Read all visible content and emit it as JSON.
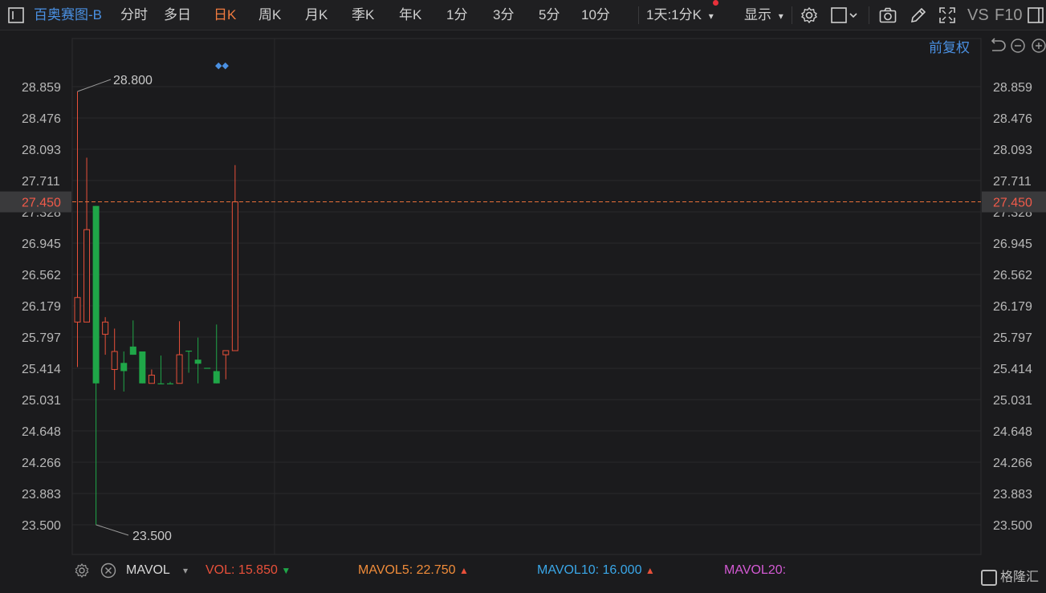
{
  "toolbar": {
    "title": "百奥赛图-B",
    "periods": [
      "分时",
      "多日",
      "日K",
      "周K",
      "月K",
      "季K",
      "年K",
      "1分",
      "3分",
      "5分",
      "10分"
    ],
    "active_period": "日K",
    "interval_select": "1天:1分K",
    "display_label": "显示",
    "vs_label": "VS",
    "f10_label": "F10"
  },
  "adjust_label": "前复权",
  "colors": {
    "up": "#e8503a",
    "down": "#1fa648",
    "accent": "#4a90e2",
    "active": "#f07b3f",
    "price_line": "#e8703a"
  },
  "chart_data": {
    "type": "candlestick",
    "y_ticks": [
      "28.859",
      "28.476",
      "28.093",
      "27.711",
      "27.328",
      "26.945",
      "26.562",
      "26.179",
      "25.797",
      "25.414",
      "25.031",
      "24.648",
      "24.266",
      "23.883",
      "23.500"
    ],
    "ylim": [
      23.5,
      28.859
    ],
    "current_price": "27.450",
    "high_label": "28.800",
    "low_label": "23.500",
    "candles": [
      {
        "open": 25.98,
        "high": 28.8,
        "low": 25.43,
        "close": 26.28
      },
      {
        "open": 25.98,
        "high": 27.99,
        "low": 25.98,
        "close": 27.11
      },
      {
        "open": 27.4,
        "high": 27.4,
        "low": 23.5,
        "close": 25.23
      },
      {
        "open": 25.83,
        "high": 26.04,
        "low": 25.58,
        "close": 25.98
      },
      {
        "open": 25.4,
        "high": 25.9,
        "low": 25.15,
        "close": 25.62
      },
      {
        "open": 25.48,
        "high": 25.62,
        "low": 25.13,
        "close": 25.38
      },
      {
        "open": 25.68,
        "high": 26.0,
        "low": 25.58,
        "close": 25.58
      },
      {
        "open": 25.62,
        "high": 25.62,
        "low": 25.23,
        "close": 25.23
      },
      {
        "open": 25.23,
        "high": 25.4,
        "low": 25.23,
        "close": 25.33
      },
      {
        "open": 25.23,
        "high": 25.57,
        "low": 25.23,
        "close": 25.23
      },
      {
        "open": 25.23,
        "high": 25.25,
        "low": 25.23,
        "close": 25.23
      },
      {
        "open": 25.23,
        "high": 25.99,
        "low": 25.23,
        "close": 25.58
      },
      {
        "open": 25.63,
        "high": 25.63,
        "low": 25.36,
        "close": 25.63
      },
      {
        "open": 25.52,
        "high": 25.79,
        "low": 25.23,
        "close": 25.47
      },
      {
        "open": 25.42,
        "high": 25.42,
        "low": 25.42,
        "close": 25.42
      },
      {
        "open": 25.38,
        "high": 25.95,
        "low": 25.23,
        "close": 25.23
      },
      {
        "open": 25.58,
        "high": 25.63,
        "low": 25.28,
        "close": 25.63
      },
      {
        "open": 25.63,
        "high": 27.9,
        "low": 25.63,
        "close": 27.45
      }
    ],
    "markers": "◆◆"
  },
  "volume_bar": {
    "indicator": "MAVOL",
    "vol_label": "VOL:",
    "vol_value": "15.850",
    "mavol5_label": "MAVOL5:",
    "mavol5_value": "22.750",
    "mavol10_label": "MAVOL10:",
    "mavol10_value": "16.000",
    "mavol20_label": "MAVOL20:",
    "vol_color": "#e8503a",
    "mavol5_color": "#f08c3a",
    "mavol10_color": "#3aa7e8",
    "mavol20_color": "#d45ad4"
  },
  "logo_text": "格隆汇"
}
